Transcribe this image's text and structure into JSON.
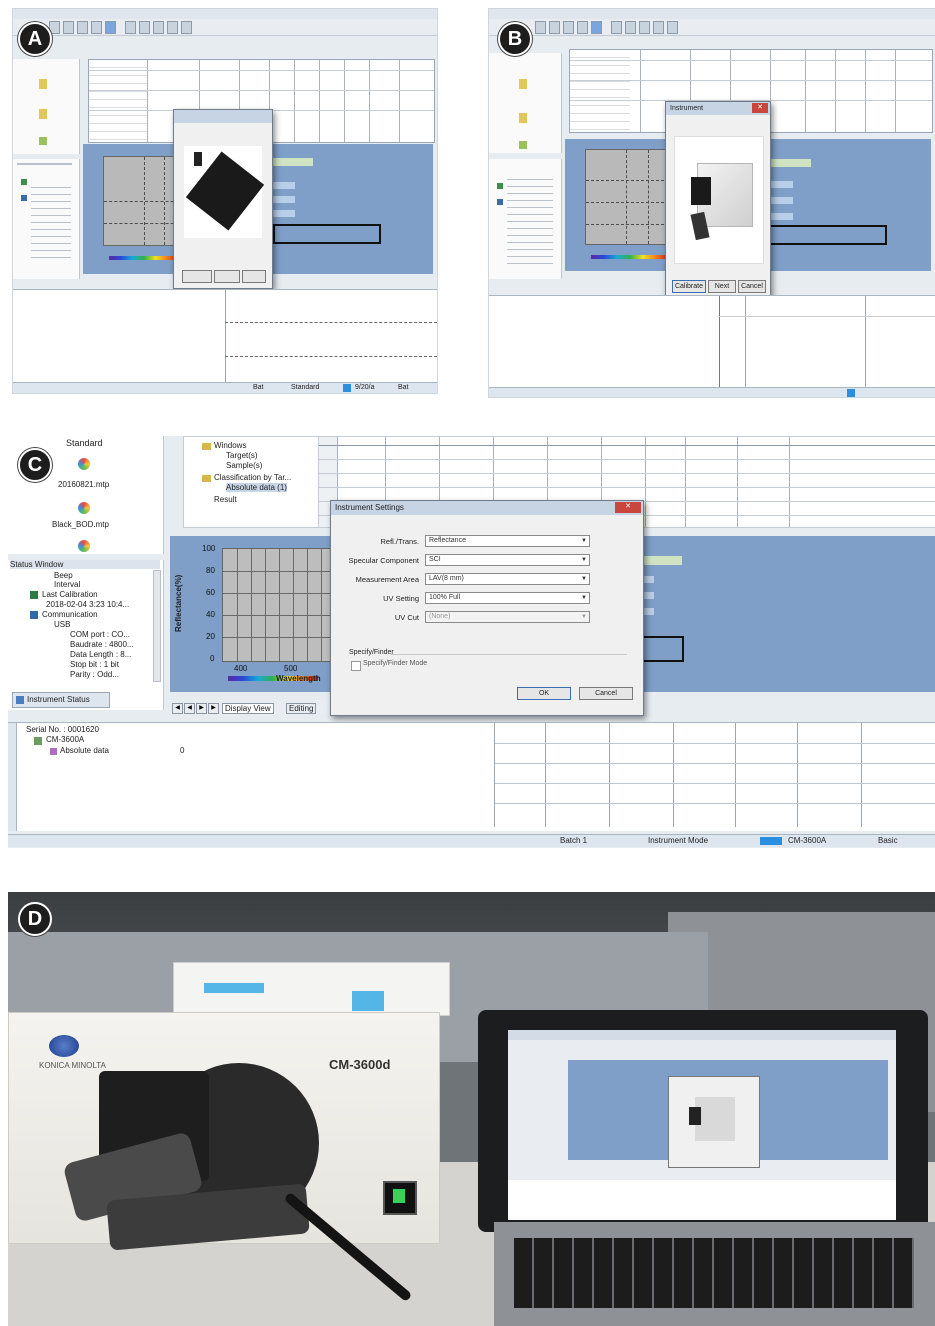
{
  "panels": {
    "a": {
      "badge": "A",
      "status": {
        "s1": "Bat",
        "s2": "Standard",
        "s3": "9/20/a",
        "s4": "Bat"
      }
    },
    "b": {
      "badge": "B",
      "dialog": {
        "title": "Instrument",
        "ok": "Calibrate",
        "next": "Next",
        "cancel": "Cancel"
      }
    },
    "c": {
      "badge": "C",
      "left_header": "Standard",
      "file1": "20160821.mtp",
      "file2": "Black_BOD.mtp",
      "status_window_title": "Status Window",
      "status_items": [
        "Beep",
        "Interval",
        "Last Calibration",
        "2018-02-04 3:23 10:4...",
        "Communication",
        "USB",
        "COM port : CO...",
        "Baudrate : 4800...",
        "Data Length : 8...",
        "Stop bit : 1 bit",
        "Parity : Odd..."
      ],
      "instrument_status_tab": "Instrument Status",
      "tree": {
        "item1": "Windows",
        "item2": "Target(s)",
        "item3": "Sample(s)",
        "item4": "Classification by Tar...",
        "item5": "Absolute data (1)",
        "item6": "Result"
      },
      "chart": {
        "ylabel": "Reflectance(%)",
        "xlabel": "Wavelength",
        "yticks": [
          "100",
          "80",
          "60",
          "40",
          "20",
          "0"
        ],
        "xticks": [
          "400",
          "500"
        ]
      },
      "view_tabs": [
        "Display View",
        "Editing"
      ],
      "dialog": {
        "title": "Instrument Settings",
        "fields": [
          {
            "label": "Refl./Trans.",
            "value": "Reflectance"
          },
          {
            "label": "Specular Component",
            "value": "SCI"
          },
          {
            "label": "Measurement Area",
            "value": "LAV(8 mm)"
          },
          {
            "label": "UV Setting",
            "value": "100% Full"
          },
          {
            "label": "UV Cut",
            "value": "(None)"
          }
        ],
        "group_title": "Specify/Finder",
        "checkbox_label": "Specify/Finder Mode",
        "ok": "OK",
        "cancel": "Cancel"
      },
      "bottom": {
        "serial": "Serial No. : 0001620",
        "device": "CM-3600A",
        "abs_label": "Absolute data",
        "abs_value": "0"
      },
      "status": {
        "s1": "Batch 1",
        "s2": "Instrument Mode",
        "s3": "CM-3600A",
        "s4": "Basic"
      }
    },
    "d": {
      "badge": "D",
      "device_brand": "KONICA MINOLTA",
      "device_model": "CM-3600d"
    }
  },
  "colors": {
    "window_blue": "#7f9fc8",
    "chart_gray": "#b9b9b9",
    "status_bar": "#dde5ef",
    "badge": "#1d1d1d"
  }
}
